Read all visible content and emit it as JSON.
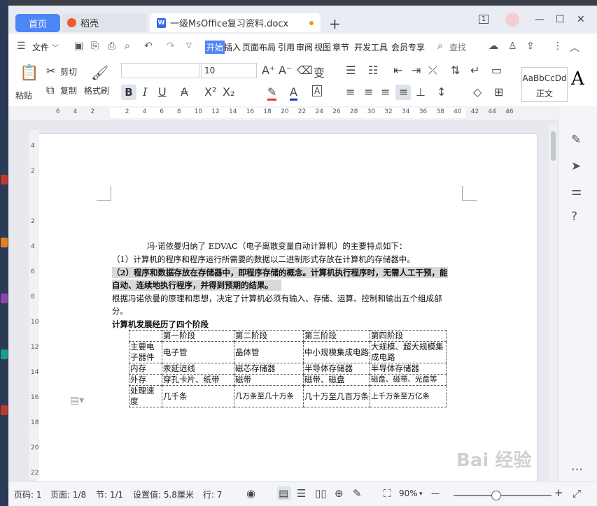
{
  "tabs": {
    "home": "首页",
    "daoke": "稻壳",
    "doc": "一级MsOffice复习资料.docx",
    "new_tab": "+"
  },
  "window_controls": {
    "badge": "1",
    "minimize": "—",
    "maximize": "☐",
    "close": "✕"
  },
  "menu": {
    "file": "文件",
    "items": [
      "开始",
      "插入",
      "页面布局",
      "引用",
      "审阅",
      "视图",
      "章节",
      "开发工具",
      "会员专享"
    ],
    "search": "查找"
  },
  "ribbon": {
    "paste": "粘贴",
    "cut": "剪切",
    "copy": "复制",
    "format_painter": "格式刷",
    "font_size": "10",
    "style_preview": "AaBbCcDd",
    "style_name": "正文",
    "big_a": "A"
  },
  "ruler": {
    "ticks": [
      "6",
      "4",
      "2",
      "",
      "2",
      "4",
      "6",
      "8",
      "10",
      "12",
      "14",
      "16",
      "18",
      "20",
      "22",
      "24",
      "26",
      "28",
      "30",
      "32",
      "34",
      "36",
      "38",
      "40",
      "42",
      "44",
      "46"
    ],
    "vticks": [
      "4",
      "2",
      "",
      "2",
      "4",
      "6",
      "8",
      "10",
      "12",
      "14",
      "16",
      "18",
      "20",
      "22"
    ]
  },
  "document": {
    "p1": "冯·诺依曼归纳了 EDVAC（电子离散变量自动计算机）的主要特点如下：",
    "p2": "（1）计算机的程序和程序运行所需要的数据以二进制形式存放在计算机的存储器中。",
    "p3a": "（2）程序和数据存放在存储器中，即程序存储的概念。计算机执行程序时，无需人工干预，能",
    "p3b": "自动、连续地执行程序，并得到预期的结果。",
    "p4a": "根据冯诺依曼的原理和思想，决定了计算机必须有输入、存储、运算、控制和输出五个组成部",
    "p4b": "分。",
    "p5": "计算机发展经历了四个阶段",
    "table": [
      [
        "",
        "第一阶段",
        "第二阶段",
        "第三阶段",
        "第四阶段"
      ],
      [
        "主要电子器件",
        "电子管",
        "晶体管",
        "中小规模集成电路",
        "大规模、超大规模集成电路"
      ],
      [
        "内存",
        "汞延迟线",
        "磁芯存储器",
        "半导体存储器",
        "半导体存储器"
      ],
      [
        "外存",
        "穿孔卡片、纸带",
        "磁带",
        "磁带、磁盘",
        "磁盘、磁带、光盘等"
      ],
      [
        "处理速度",
        "几千条",
        "几万条至几十万条",
        "几十万至几百万条",
        "上千万条至万亿条"
      ]
    ]
  },
  "status": {
    "page_num": "页码: 1",
    "pages": "页面: 1/8",
    "section": "节: 1/1",
    "setting": "设置值: 5.8厘米",
    "row": "行: 7",
    "zoom": "90%",
    "zoom_minus": "—",
    "zoom_plus": "+",
    "zoom_level": 0.43
  },
  "watermark": "Bai 经验"
}
